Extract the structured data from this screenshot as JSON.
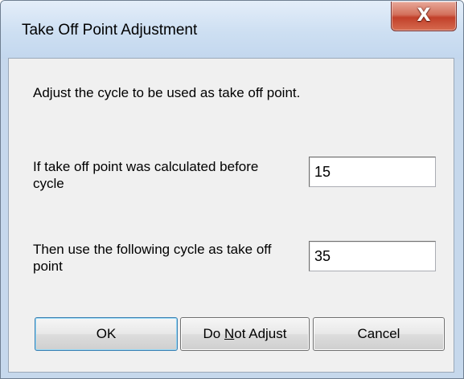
{
  "window": {
    "title": "Take Off Point Adjustment",
    "close_label": "X"
  },
  "content": {
    "intro": "Adjust the cycle to be used as take off point.",
    "calculated_label": "If take off point was calculated before cycle",
    "calculated_value": "15",
    "use_label": "Then use the following cycle as take off point",
    "use_value": "35"
  },
  "buttons": {
    "ok": "OK",
    "no_adjust_prefix": "Do ",
    "no_adjust_mnemonic": "N",
    "no_adjust_suffix": "ot Adjust",
    "cancel": "Cancel"
  },
  "colors": {
    "close_button": "#c2402a",
    "titlebar": "#cddff2",
    "client": "#f0f0f0"
  }
}
